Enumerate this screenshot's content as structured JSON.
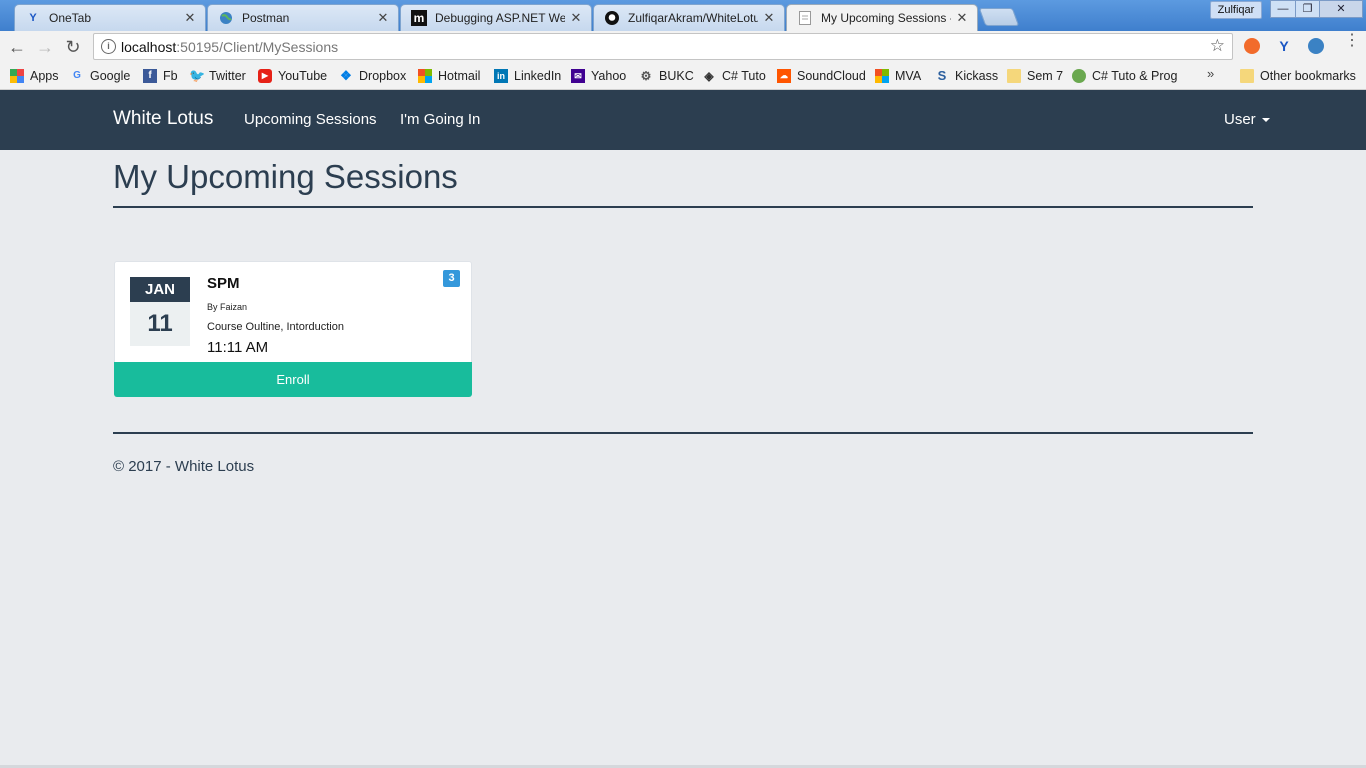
{
  "browser": {
    "tabs": [
      {
        "title": "OneTab",
        "icon": "onetab-icon",
        "active": false
      },
      {
        "title": "Postman",
        "icon": "globe-icon",
        "active": false
      },
      {
        "title": "Debugging ASP.NET Wel",
        "icon": "medium-icon",
        "active": false
      },
      {
        "title": "ZulfiqarAkram/WhiteLotu",
        "icon": "github-icon",
        "active": false
      },
      {
        "title": "My Upcoming Sessions -",
        "icon": "page-icon",
        "active": true
      }
    ],
    "close_glyph": "✕",
    "profile_name": "Zulfiqar",
    "window_buttons": {
      "minimize": "—",
      "maximize": "❐",
      "close": "✕"
    },
    "url_host": "localhost",
    "url_rest": ":50195/Client/MySessions",
    "bookmarks": [
      {
        "label": "Apps",
        "icon": "apps-grid-icon",
        "color": "#e44"
      },
      {
        "label": "Google",
        "icon": "google-icon",
        "color": "#4285f4"
      },
      {
        "label": "Fb",
        "icon": "facebook-icon",
        "color": "#3b5998"
      },
      {
        "label": "Twitter",
        "icon": "twitter-icon",
        "color": "#1da1f2"
      },
      {
        "label": "YouTube",
        "icon": "youtube-icon",
        "color": "#e62117"
      },
      {
        "label": "Dropbox",
        "icon": "dropbox-icon",
        "color": "#007ee5"
      },
      {
        "label": "Hotmail",
        "icon": "windows-icon",
        "color": "#f25022"
      },
      {
        "label": "LinkedIn",
        "icon": "linkedin-icon",
        "color": "#0077b5"
      },
      {
        "label": "Yahoo",
        "icon": "mail-icon",
        "color": "#400191"
      },
      {
        "label": "BUKC",
        "icon": "crest-icon",
        "color": "#666"
      },
      {
        "label": "C# Tuto",
        "icon": "diamond-icon",
        "color": "#333"
      },
      {
        "label": "SoundCloud",
        "icon": "soundcloud-icon",
        "color": "#ff5500"
      },
      {
        "label": "MVA",
        "icon": "windows-icon",
        "color": "#7fba00"
      },
      {
        "label": "Kickass",
        "icon": "kickass-icon",
        "color": "#2b5f9e"
      },
      {
        "label": "Sem 7",
        "icon": "folder-icon",
        "color": "#f5d77b"
      },
      {
        "label": "C# Tuto & Prog",
        "icon": "leaf-icon",
        "color": "#6aa84f"
      }
    ],
    "other_bookmarks": "Other bookmarks",
    "overflow": "»"
  },
  "navbar": {
    "brand": "White Lotus",
    "links": [
      "Upcoming Sessions",
      "I'm Going In"
    ],
    "user_menu": "User"
  },
  "main": {
    "title": "My Upcoming Sessions",
    "sessions": [
      {
        "month": "JAN",
        "day": "11",
        "title": "SPM",
        "by": "By Faizan",
        "topics": "Course Oultine, Intorduction",
        "time": "11:11 AM",
        "badge": "3",
        "action": "Enroll"
      }
    ]
  },
  "footer": {
    "text": "© 2017 - White Lotus"
  },
  "colors": {
    "navbar": "#2c3e50",
    "enroll": "#18bc9c",
    "badge": "#3498db",
    "page_bg": "#e9ebee"
  }
}
